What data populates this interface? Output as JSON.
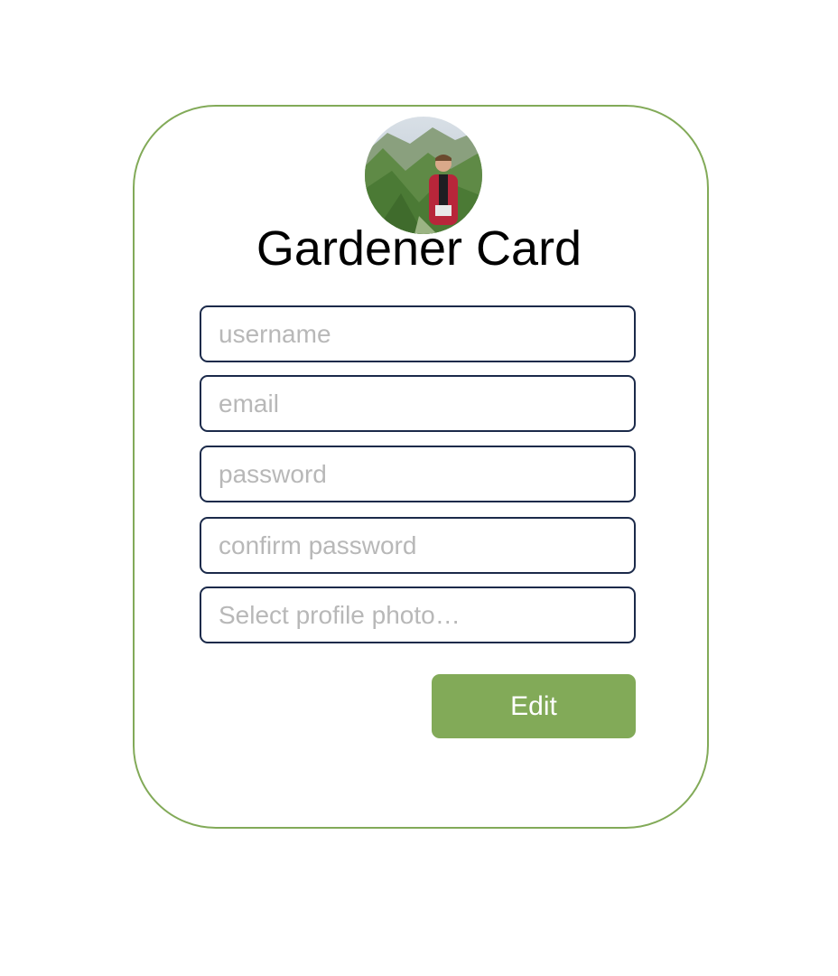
{
  "card": {
    "title": "Gardener Card",
    "border_color": "#82aa58"
  },
  "avatar": {
    "icon": "profile-photo"
  },
  "form": {
    "username": {
      "value": "",
      "placeholder": "username"
    },
    "email": {
      "value": "",
      "placeholder": "email"
    },
    "password": {
      "value": "",
      "placeholder": "password"
    },
    "confirm_password": {
      "value": "",
      "placeholder": "confirm password"
    },
    "profile_photo": {
      "placeholder": "Select profile photo…"
    }
  },
  "actions": {
    "edit_label": "Edit",
    "edit_color": "#82aa58"
  }
}
